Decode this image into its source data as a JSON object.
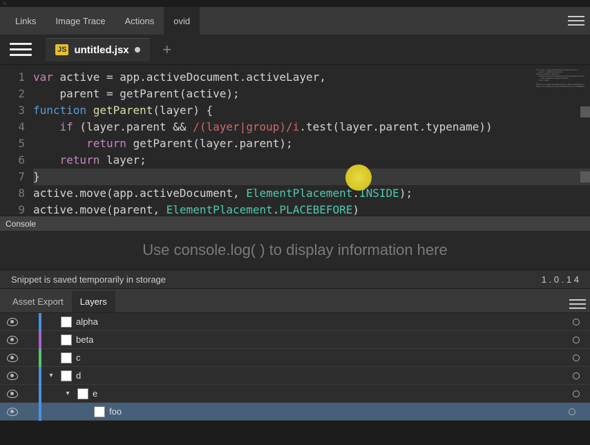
{
  "top_tabs": {
    "items": [
      "Links",
      "Image Trace",
      "Actions",
      "ovid"
    ],
    "active_index": 3
  },
  "editor_tab": {
    "badge": "JS",
    "filename": "untitled.jsx",
    "dirty": true
  },
  "code_lines": [
    {
      "n": 1,
      "tokens": [
        [
          "kw",
          "var"
        ],
        [
          "",
          " active = app.activeDocument.activeLayer,"
        ]
      ]
    },
    {
      "n": 2,
      "tokens": [
        [
          "",
          "    parent = getParent(active);"
        ]
      ]
    },
    {
      "n": 3,
      "tokens": [
        [
          "kw2",
          "function"
        ],
        [
          "",
          " "
        ],
        [
          "fn",
          "getParent"
        ],
        [
          "",
          "(layer) {"
        ]
      ]
    },
    {
      "n": 4,
      "tokens": [
        [
          "",
          "    "
        ],
        [
          "kw",
          "if"
        ],
        [
          "",
          " (layer.parent && "
        ],
        [
          "rx",
          "/(layer|group)/i"
        ],
        [
          "",
          ".test(layer.parent.typename))"
        ]
      ]
    },
    {
      "n": 5,
      "tokens": [
        [
          "",
          "        "
        ],
        [
          "kw",
          "return"
        ],
        [
          "",
          " getParent(layer.parent);"
        ]
      ]
    },
    {
      "n": 6,
      "tokens": [
        [
          "",
          "    "
        ],
        [
          "kw",
          "return"
        ],
        [
          "",
          " layer;"
        ]
      ]
    },
    {
      "n": 7,
      "tokens": [
        [
          "",
          "}"
        ]
      ],
      "hl": true
    },
    {
      "n": 8,
      "tokens": [
        [
          "",
          "active.move(app.activeDocument, "
        ],
        [
          "type",
          "ElementPlacement"
        ],
        [
          "",
          "."
        ],
        [
          "const",
          "INSIDE"
        ],
        [
          "",
          ");"
        ]
      ]
    },
    {
      "n": 9,
      "tokens": [
        [
          "",
          "active.move(parent, "
        ],
        [
          "type",
          "ElementPlacement"
        ],
        [
          "",
          "."
        ],
        [
          "const",
          "PLACEBEFORE"
        ],
        [
          "",
          ")"
        ]
      ]
    }
  ],
  "console": {
    "title": "Console",
    "placeholder": "Use console.log( ) to display information here"
  },
  "status": {
    "message": "Snippet is saved temporarily in storage",
    "version": "1 . 0 . 1 4"
  },
  "panel_tabs": {
    "items": [
      "Asset Export",
      "Layers"
    ],
    "active_index": 1
  },
  "layers": [
    {
      "name": "alpha",
      "color": "#4a90e2",
      "depth": 0,
      "twisty": null,
      "selected": false
    },
    {
      "name": "beta",
      "color": "#b15fc9",
      "depth": 0,
      "twisty": null,
      "selected": false
    },
    {
      "name": "c",
      "color": "#4fc96a",
      "depth": 0,
      "twisty": null,
      "selected": false
    },
    {
      "name": "d",
      "color": "#4a90e2",
      "depth": 0,
      "twisty": "down",
      "selected": false
    },
    {
      "name": "e",
      "color": "#4a90e2",
      "depth": 1,
      "twisty": "down",
      "selected": false
    },
    {
      "name": "foo",
      "color": "#4a90e2",
      "depth": 2,
      "twisty": null,
      "selected": true
    }
  ]
}
